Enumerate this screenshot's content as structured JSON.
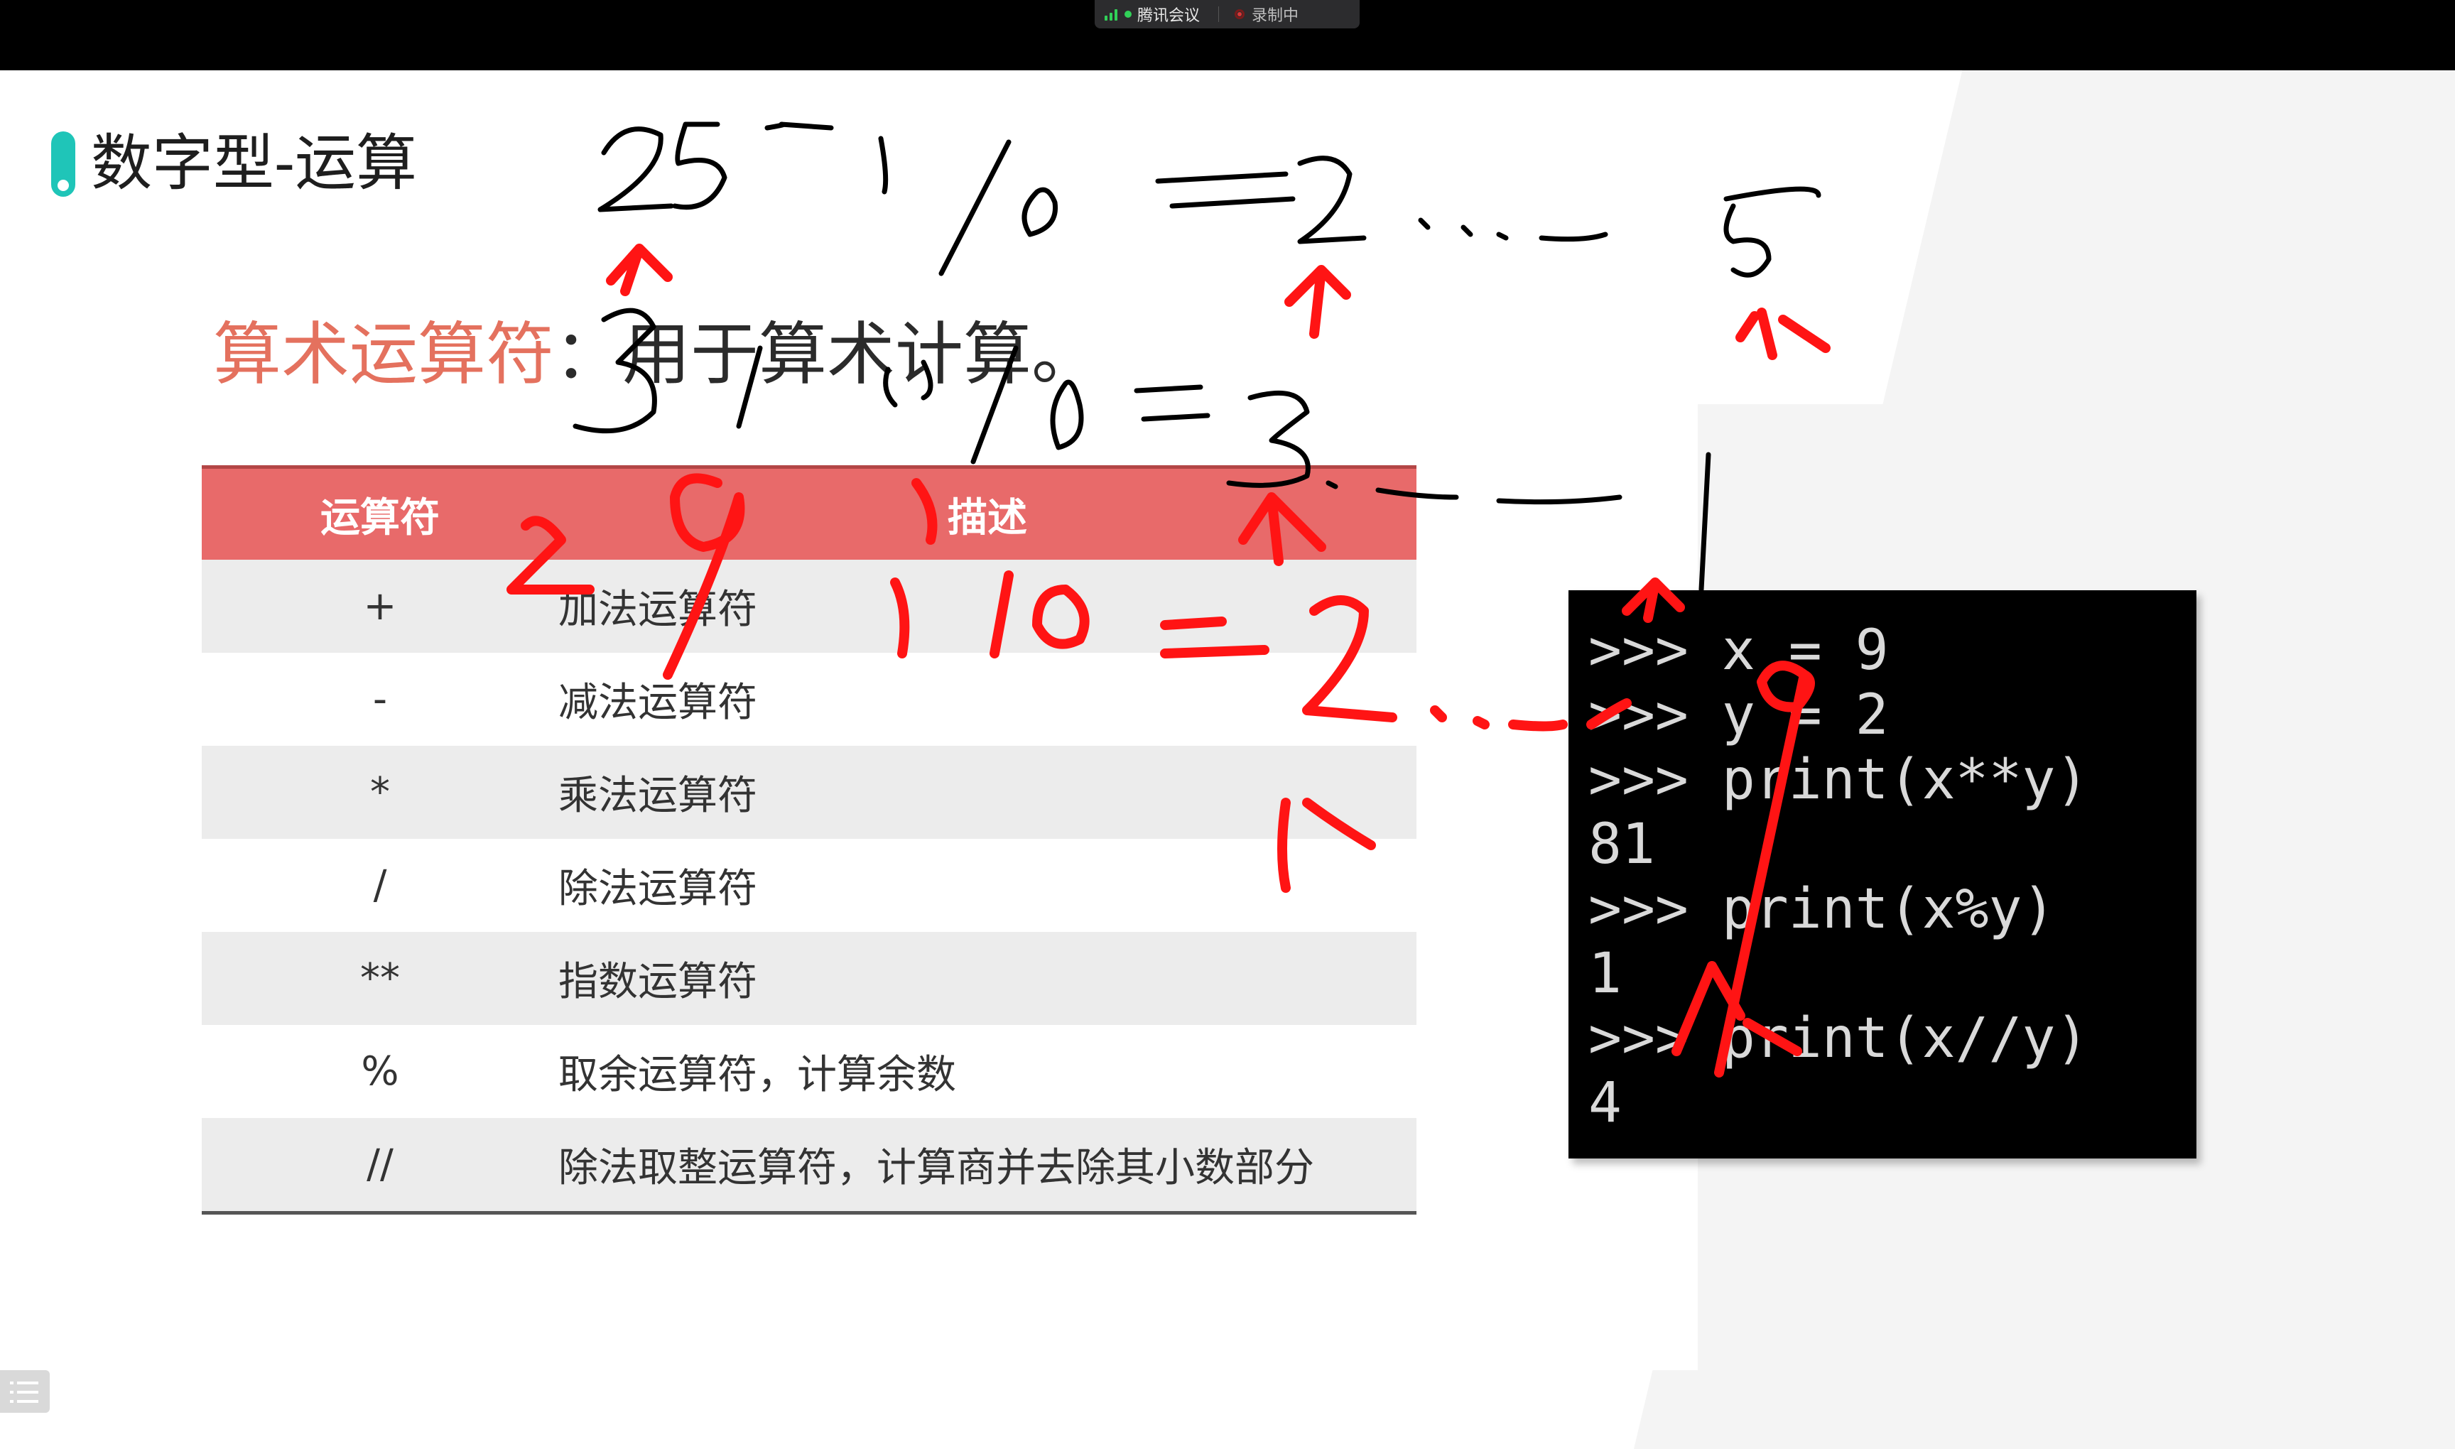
{
  "meeting_bar": {
    "app_name": "腾讯会议",
    "recording_status": "录制中"
  },
  "slide": {
    "title": "数字型-运算",
    "subtitle_highlight": "算术运算符",
    "subtitle_rest": "：用于算术计算。",
    "table": {
      "headers": [
        "运算符",
        "描述"
      ],
      "rows": [
        {
          "op": "+",
          "desc": "加法运算符"
        },
        {
          "op": "-",
          "desc": "减法运算符"
        },
        {
          "op": "*",
          "desc": "乘法运算符"
        },
        {
          "op": "/",
          "desc": "除法运算符"
        },
        {
          "op": "**",
          "desc": "指数运算符"
        },
        {
          "op": "%",
          "desc": "取余运算符，计算余数"
        },
        {
          "op": "//",
          "desc": "除法取整运算符，计算商并去除其小数部分"
        }
      ]
    },
    "console_lines": [
      ">>> x = 9",
      ">>> y = 2",
      ">>> print(x**y)",
      "81",
      ">>> print(x%y)",
      "1",
      ">>> print(x//y)",
      "4"
    ]
  },
  "colors": {
    "accent_teal": "#1fc5b8",
    "header_red": "#e86a6a",
    "subtitle_red": "#e4715e",
    "ink_red": "#ff0000",
    "ink_black": "#000000"
  },
  "icons": [
    "signal-icon",
    "recording-icon",
    "list-icon"
  ]
}
